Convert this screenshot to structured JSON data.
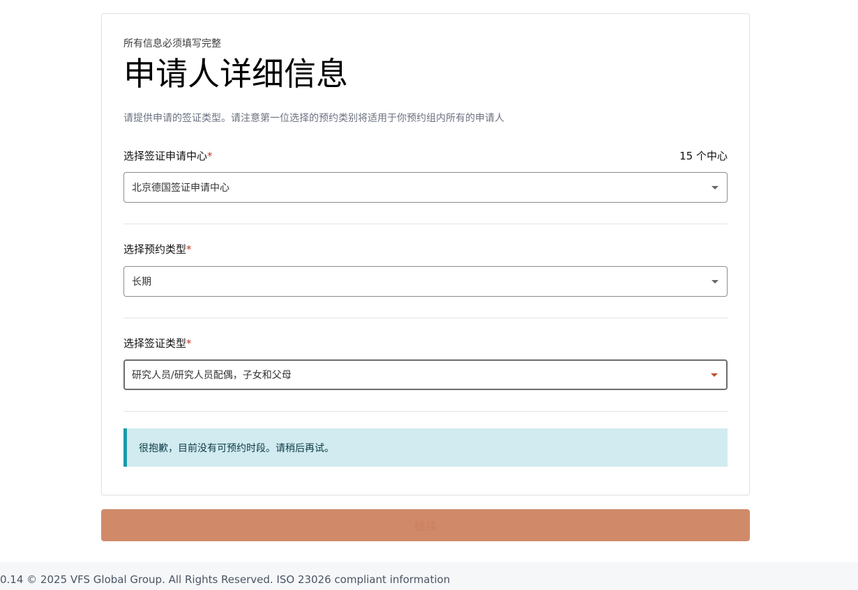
{
  "header": {
    "required_note": "所有信息必须填写完整",
    "title": "申请人详细信息",
    "description": "请提供申请的签证类型。请注意第一位选择的预约类别将适用于你预约组内所有的申请人"
  },
  "fields": {
    "center": {
      "label": "选择签证申请中心",
      "required_mark": "*",
      "count_text": "15 个中心",
      "value": "北京德国签证申请中心"
    },
    "appointment_type": {
      "label": "选择预约类型",
      "required_mark": "*",
      "value": "长期"
    },
    "visa_type": {
      "label": "选择签证类型",
      "required_mark": "*",
      "value": "研究人员/研究人员配偶，子女和父母"
    }
  },
  "alert": {
    "message": "很抱歉，目前没有可预约时段。请稍后再试。"
  },
  "actions": {
    "continue_label": "继续"
  },
  "footer": {
    "text": "0.14 © 2025 VFS Global Group. All Rights Reserved. ISO 23026 compliant information"
  },
  "colors": {
    "accent": "#c2502a",
    "button": "#d08a6a",
    "alert_bg": "#d1ebf0",
    "alert_border": "#1a9aaa"
  },
  "icons": [
    "chevron-down-icon"
  ]
}
